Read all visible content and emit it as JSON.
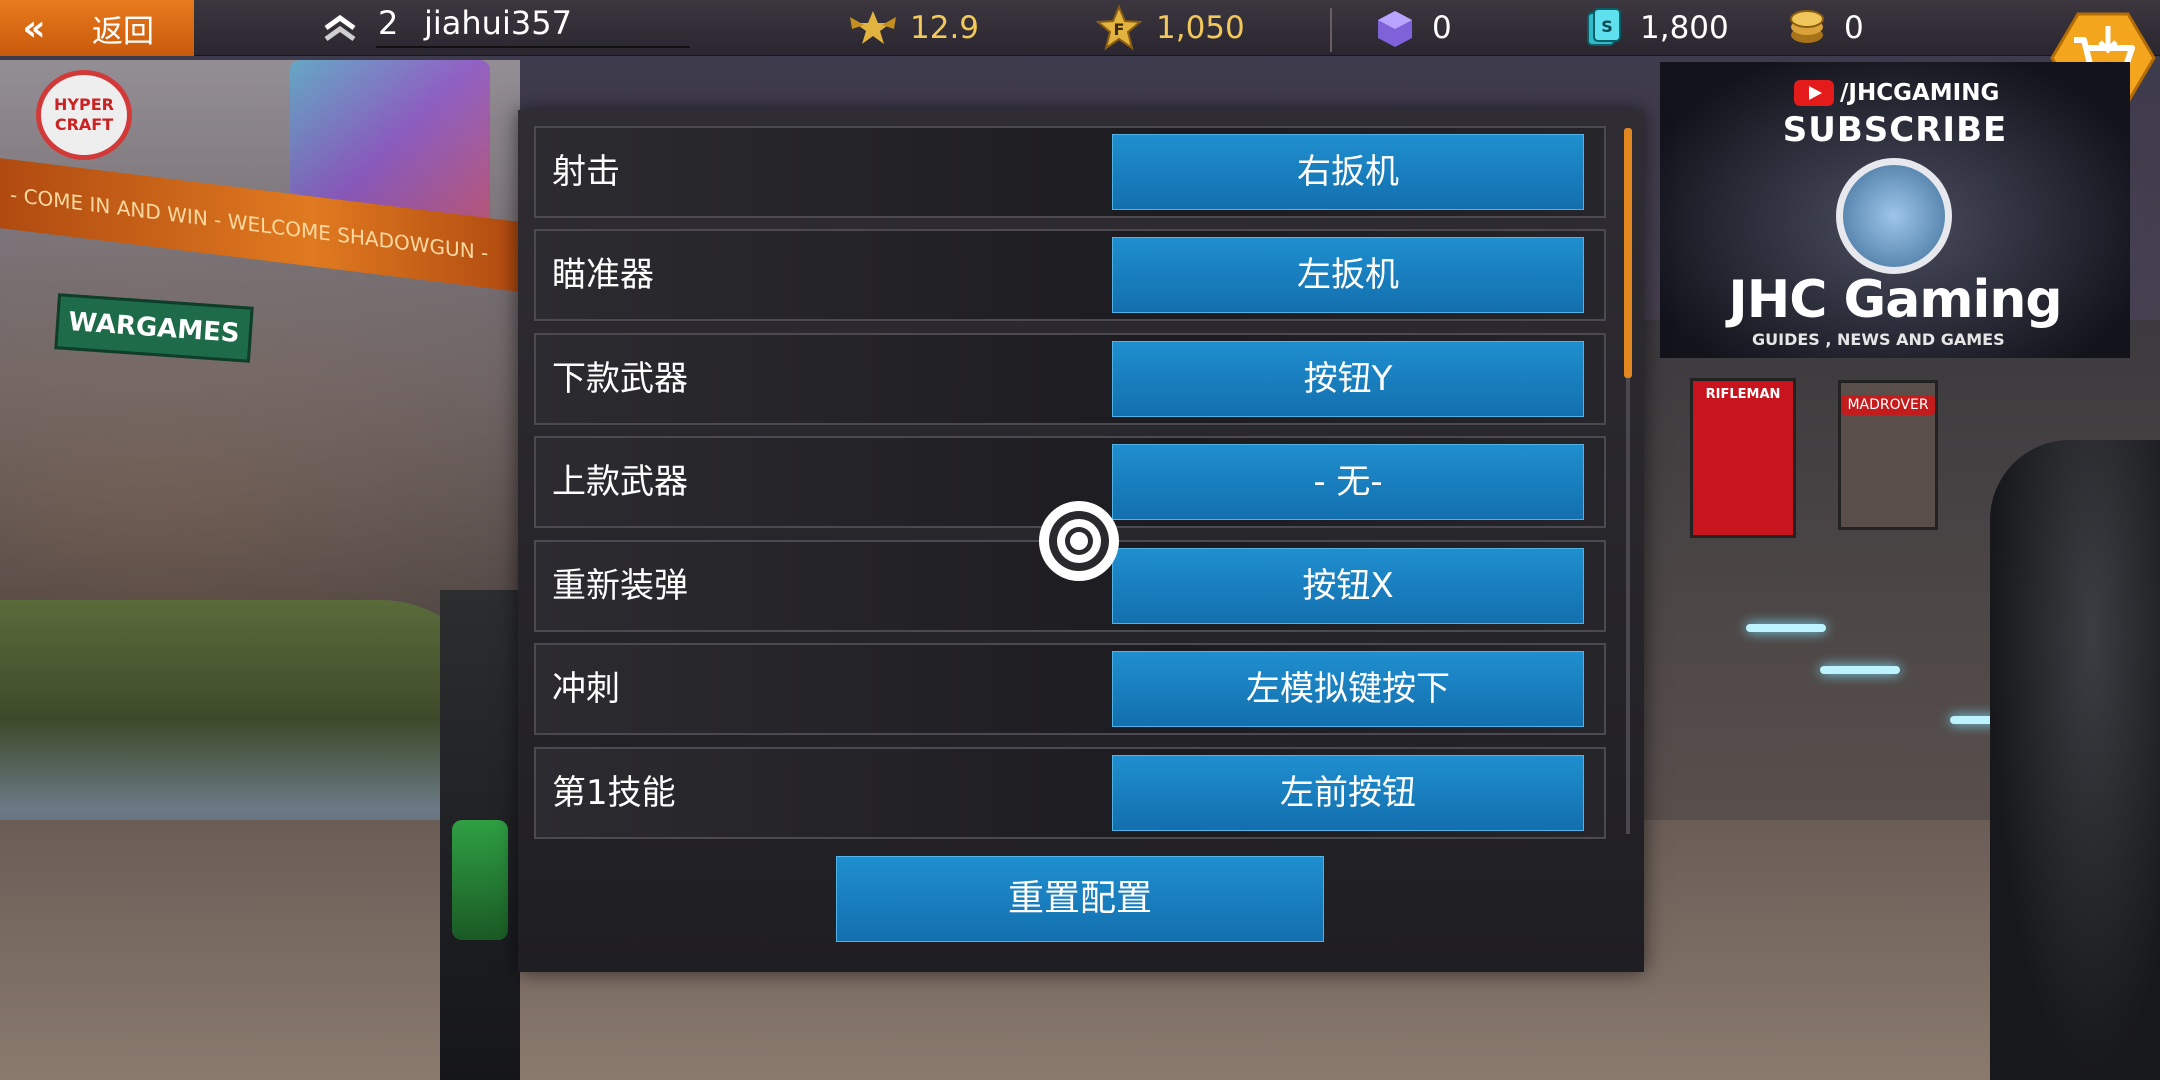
{
  "topbar": {
    "back_label": "返回",
    "rank": "2",
    "username": "jiahui357",
    "stats": {
      "power": "12.9",
      "fame": "1,050",
      "gems": "0",
      "credits": "1,800",
      "gold": "0"
    }
  },
  "promo": {
    "handle": "/JHCGAMING",
    "subscribe": "SUBSCRIBE",
    "brand": "JHC Gaming",
    "tagline": "GUIDES , NEWS AND GAMES"
  },
  "scene": {
    "band_text": "- COME IN AND WIN  -  WELCOME SHADOWGUN -",
    "hyper_text": "HYPER CRAFT",
    "wargames_text": "WARGAMES",
    "rifleman_text": "RIFLEMAN",
    "madrover_text": "MADROVER"
  },
  "controls": {
    "rows": [
      {
        "action": "射击",
        "binding": "右扳机"
      },
      {
        "action": "瞄准器",
        "binding": "左扳机"
      },
      {
        "action": "下款武器",
        "binding": "按钮Y"
      },
      {
        "action": "上款武器",
        "binding": "- 无-"
      },
      {
        "action": "重新装弹",
        "binding": "按钮X"
      },
      {
        "action": "冲刺",
        "binding": "左模拟键按下"
      },
      {
        "action": "第1技能",
        "binding": "左前按钮"
      }
    ],
    "reset_label": "重置配置"
  },
  "colors": {
    "accent_orange": "#e87a1e",
    "button_blue": "#1a80c0",
    "gold_text": "#f2c85a"
  },
  "icons": {
    "back": "double-chevron-left-icon",
    "rank": "rank-chevron-icon",
    "power": "winged-star-icon",
    "fame": "fame-star-icon",
    "gems": "gem-cube-icon",
    "credits": "credits-stack-icon",
    "gold": "gold-coin-icon",
    "cart": "shopping-cart-icon",
    "target": "target-reticle-icon"
  }
}
